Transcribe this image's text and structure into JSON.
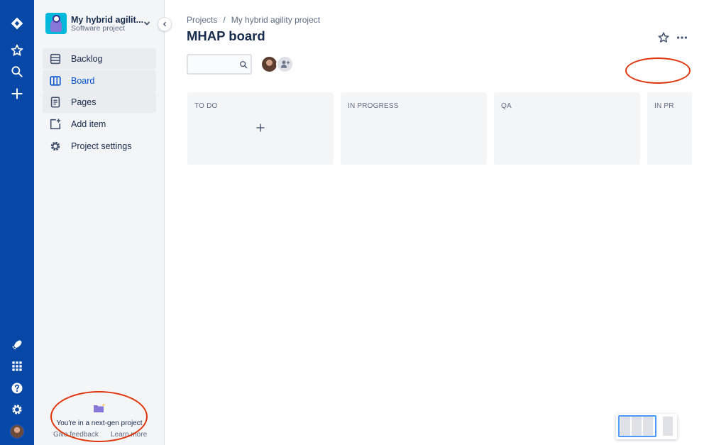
{
  "project": {
    "name": "My hybrid agilit...",
    "type": "Software project"
  },
  "sidebar": {
    "items": [
      {
        "label": "Backlog",
        "icon": "backlog-icon"
      },
      {
        "label": "Board",
        "icon": "board-icon",
        "selected": true
      },
      {
        "label": "Pages",
        "icon": "pages-icon"
      },
      {
        "label": "Add item",
        "icon": "add-item-icon"
      },
      {
        "label": "Project settings",
        "icon": "gear-icon"
      }
    ],
    "next_gen": {
      "message": "You're in a next-gen project",
      "feedback_link": "Give feedback",
      "learn_link": "Learn more"
    }
  },
  "global_nav": {
    "top_icons": [
      "jira-logo-icon",
      "star-icon",
      "search-icon",
      "plus-icon"
    ],
    "bottom_icons": [
      "rocket-icon",
      "app-switcher-icon",
      "help-icon",
      "gear-icon",
      "profile-avatar"
    ]
  },
  "breadcrumb": {
    "root": "Projects",
    "separator": "/",
    "project": "My hybrid agility project"
  },
  "board": {
    "title": "MHAP board",
    "search_placeholder": "",
    "columns": [
      {
        "title": "TO DO"
      },
      {
        "title": "IN PROGRESS"
      },
      {
        "title": "QA"
      },
      {
        "title": "IN PR"
      }
    ]
  },
  "colors": {
    "global_nav_bg": "#0747a6",
    "sidebar_bg": "#f4f5f7",
    "selected": "#0052cc",
    "annotation": "#de350b",
    "column_bg": "#f4f5f7"
  }
}
